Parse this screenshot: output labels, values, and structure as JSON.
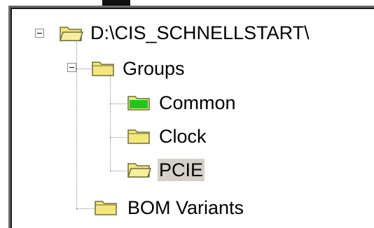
{
  "tree": {
    "root": {
      "label": "D:\\CIS_SCHNELLSTART\\",
      "icon": "open-folder-icon",
      "expanded": true
    },
    "groups": {
      "label": "Groups",
      "icon": "closed-folder-icon",
      "expanded": true
    },
    "children": [
      {
        "label": "Common",
        "icon": "folder-green-icon",
        "selected": false
      },
      {
        "label": "Clock",
        "icon": "closed-folder-icon",
        "selected": false
      },
      {
        "label": "PCIE",
        "icon": "open-folder-icon",
        "selected": true
      }
    ],
    "bom": {
      "label": "BOM Variants",
      "icon": "closed-folder-icon"
    }
  },
  "colors": {
    "folder_yellow": "#f4e67a",
    "folder_green": "#22c51e",
    "selection_bg": "#d4d0c8"
  }
}
